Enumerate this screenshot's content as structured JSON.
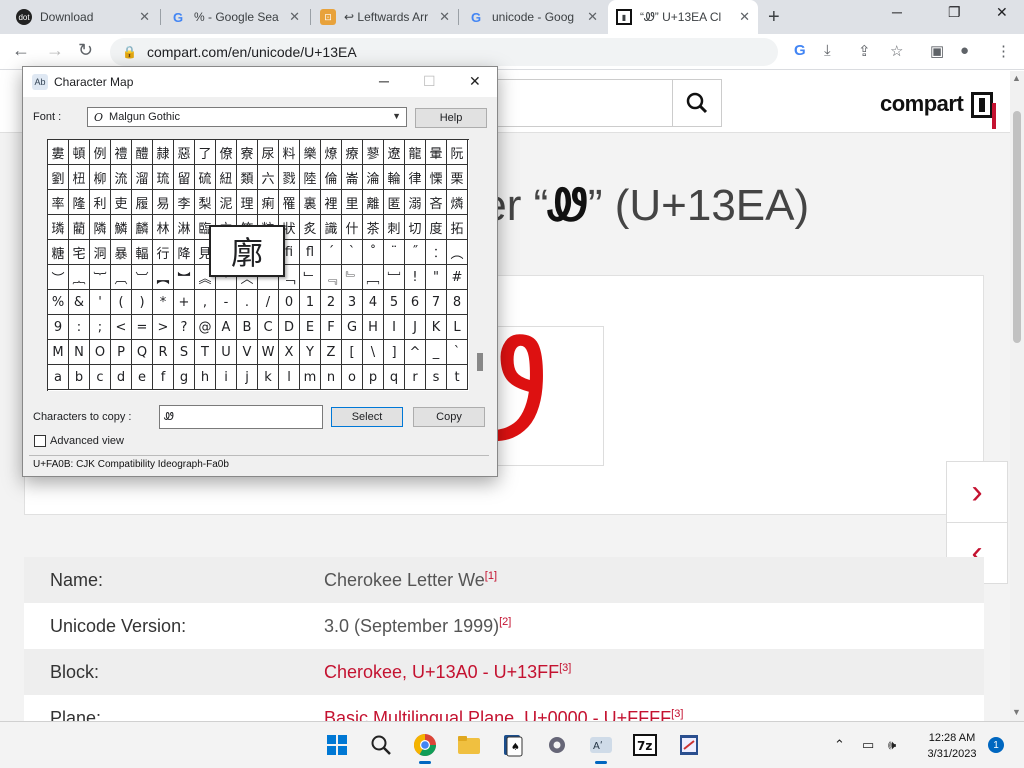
{
  "browser": {
    "tabs": [
      {
        "title": "Download",
        "favicon": "dot-favicon"
      },
      {
        "title": "% - Google Sea",
        "favicon": "google-icon"
      },
      {
        "title": "↩ Leftwards Arr",
        "favicon": "compart-icon"
      },
      {
        "title": "unicode - Goog",
        "favicon": "google-icon"
      },
      {
        "title": "“Ꮺ” U+13EA Cl",
        "favicon": "compart-icon"
      }
    ],
    "url": "compart.com/en/unicode/U+13EA"
  },
  "site": {
    "logo": "compart",
    "title_prefix": "ter “",
    "title_glyph": "Ꮺ",
    "title_suffix": "” (U+13EA)",
    "big_glyph": "Ꮺ",
    "properties": [
      {
        "label": "Name:",
        "value": "Cherokee Letter We",
        "ref": "[1]",
        "link": false
      },
      {
        "label": "Unicode Version:",
        "value": "3.0 (September 1999)",
        "ref": "[2]",
        "link": false
      },
      {
        "label": "Block:",
        "value": "Cherokee, U+13A0 - U+13FF",
        "ref": "[3]",
        "link": true
      },
      {
        "label": "Plane:",
        "value": "Basic Multilingual Plane, U+0000 - U+FFFF",
        "ref": "[3]",
        "link": true
      }
    ]
  },
  "charmap": {
    "title": "Character Map",
    "font_label": "Font :",
    "font_value": "Malgun Gothic",
    "help_label": "Help",
    "grid": [
      [
        "婁",
        "頓",
        "例",
        "禮",
        "醴",
        "隷",
        "惡",
        "了",
        "僚",
        "寮",
        "尿",
        "料",
        "樂",
        "燎",
        "療",
        "蓼",
        "遼",
        "龍",
        "暈",
        "阮"
      ],
      [
        "劉",
        "杻",
        "柳",
        "流",
        "溜",
        "琉",
        "留",
        "硫",
        "紐",
        "類",
        "六",
        "戮",
        "陸",
        "倫",
        "崙",
        "淪",
        "輪",
        "律",
        "慄",
        "栗"
      ],
      [
        "率",
        "隆",
        "利",
        "吏",
        "履",
        "易",
        "李",
        "梨",
        "泥",
        "理",
        "痢",
        "罹",
        "裏",
        "裡",
        "里",
        "離",
        "匿",
        "溺",
        "吝",
        "燐"
      ],
      [
        "璘",
        "藺",
        "隣",
        "鱗",
        "麟",
        "林",
        "淋",
        "臨",
        "立",
        "笠",
        "粒",
        "狀",
        "炙",
        "識",
        "什",
        "茶",
        "刺",
        "切",
        "度",
        "拓"
      ],
      [
        "糖",
        "宅",
        "洞",
        "暴",
        "輻",
        "行",
        "降",
        "見",
        "廓",
        "兀",
        "ﬀ",
        "ﬁ",
        "ﬂ",
        "´",
        "`",
        "˚",
        "¨",
        "˝",
        "︰",
        "︵"
      ],
      [
        "︶",
        "︷",
        "︸",
        "︹",
        "︺",
        "︻",
        "︼",
        "︽",
        "︾",
        "︿",
        "﹀",
        "﹁",
        "﹂",
        "﹃",
        "﹄",
        "﹇",
        "﹈",
        "!",
        "\"",
        "#",
        "$"
      ],
      [
        "%",
        "&",
        "'",
        "(",
        ")",
        "*",
        "+",
        ",",
        "-",
        ".",
        "/",
        "0",
        "1",
        "2",
        "3",
        "4",
        "5",
        "6",
        "7",
        "8"
      ],
      [
        "9",
        ":",
        ";",
        "<",
        "=",
        ">",
        "?",
        "@",
        "A",
        "B",
        "C",
        "D",
        "E",
        "F",
        "G",
        "H",
        "I",
        "J",
        "K",
        "L"
      ],
      [
        "M",
        "N",
        "O",
        "P",
        "Q",
        "R",
        "S",
        "T",
        "U",
        "V",
        "W",
        "X",
        "Y",
        "Z",
        "[",
        "\\",
        "]",
        "^",
        "_",
        "`"
      ],
      [
        "a",
        "b",
        "c",
        "d",
        "e",
        "f",
        "g",
        "h",
        "i",
        "j",
        "k",
        "l",
        "m",
        "n",
        "o",
        "p",
        "q",
        "r",
        "s",
        "t"
      ]
    ],
    "magnified_char": "廓",
    "copy_label": "Characters to copy :",
    "copy_value": "Ꮺ",
    "select_label": "Select",
    "copy_button": "Copy",
    "advanced_label": "Advanced view",
    "status": "U+FA0B: CJK Compatibility Ideograph-Fa0b"
  },
  "taskbar": {
    "time": "12:28 AM",
    "date": "3/31/2023",
    "notifications": "1"
  }
}
